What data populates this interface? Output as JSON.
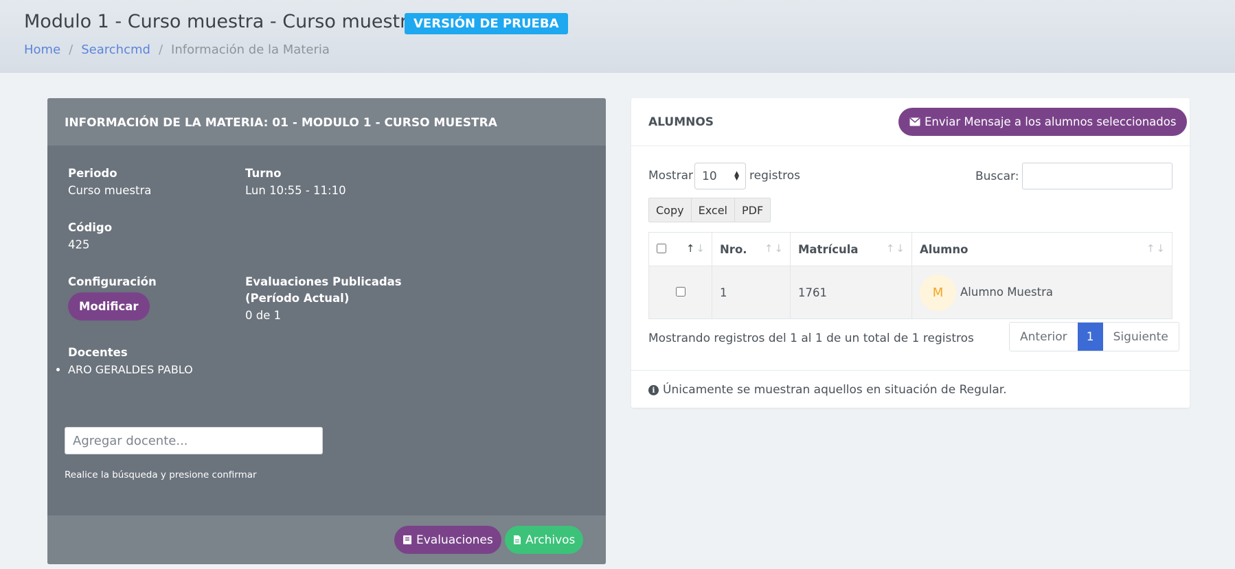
{
  "header": {
    "title": "Modulo 1 - Curso muestra - Curso muestra",
    "badge": "VERSIÓN DE PRUEBA",
    "breadcrumb": [
      "Home",
      "Searchcmd",
      "Información de la Materia"
    ]
  },
  "materia": {
    "heading": "INFORMACIÓN DE LA MATERIA: 01 - MODULO 1 - CURSO MUESTRA",
    "periodo_label": "Periodo",
    "periodo_value": "Curso muestra",
    "turno_label": "Turno",
    "turno_value": "Lun 10:55 - 11:10",
    "codigo_label": "Código",
    "codigo_value": "425",
    "config_label": "Configuración",
    "modify_button": "Modificar",
    "evals_label_1": "Evaluaciones Publicadas",
    "evals_label_2": "(Período Actual)",
    "evals_value": "0 de 1",
    "docentes_label": "Docentes",
    "docentes": [
      "ARO GERALDES PABLO"
    ],
    "add_docente_placeholder": "Agregar docente...",
    "helper": "Realice la búsqueda y presione confirmar",
    "evaluaciones_button": "Evaluaciones",
    "archivos_button": "Archivos"
  },
  "alumnos": {
    "title": "ALUMNOS",
    "send_button": "Enviar Mensaje a los alumnos seleccionados",
    "show_label": "Mostrar",
    "length_value": "10",
    "records_label": "registros",
    "search_label": "Buscar:",
    "export_buttons": [
      "Copy",
      "Excel",
      "PDF"
    ],
    "columns": [
      "",
      "Nro.",
      "Matrícula",
      "Alumno"
    ],
    "rows": [
      {
        "nro": "1",
        "matricula": "1761",
        "avatar": "M",
        "nombre": "Alumno Muestra"
      }
    ],
    "info": "Mostrando registros del 1 al 1 de un total de 1 registros",
    "pager_prev": "Anterior",
    "pager_current": "1",
    "pager_next": "Siguiente",
    "note": "Únicamente se muestran aquellos en situación de Regular."
  },
  "colors": {
    "accent_purple": "#7a4389",
    "accent_green": "#3dc27a",
    "badge_blue": "#1ea8f0",
    "page_active": "#3d6bd6"
  }
}
